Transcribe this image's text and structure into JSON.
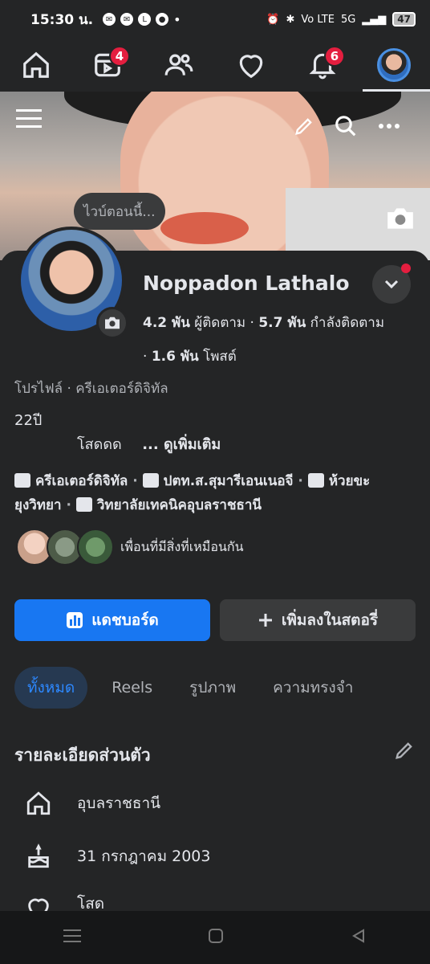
{
  "status_bar": {
    "time": "15:30 น.",
    "network": "5G",
    "volte": "Vo LTE",
    "battery": "47"
  },
  "top_nav": {
    "reels_badge": "4",
    "notifications_badge": "6"
  },
  "cover": {
    "bubble_text": "ไวบ์ตอนนี้..."
  },
  "profile": {
    "name": "Noppadon Lathalo",
    "followers_count": "4.2 พัน",
    "followers_label": "ผู้ติดตาม",
    "following_count": "5.7 พัน",
    "following_label": "กำลังติดตาม",
    "posts_count": "1.6 พัน",
    "posts_label": "โพสต์",
    "category": "โปรไฟล์ · ครีเอเตอร์ดิจิทัล",
    "age": "22ปี",
    "bio": "โสดดด",
    "see_more": "... ดูเพิ่มเติม",
    "details_line1_a": "ครีเอเตอร์ดิจิทัล",
    "details_line1_b": "ปตท.ส.สุมารีเอนเนอจี",
    "details_line1_c": "ห้วยขะ",
    "details_line2_a": "ยุงวิทยา",
    "details_line2_b": "วิทยาลัยเทคนิคอุบลราชธานี",
    "mutual_text": "เพื่อนที่มีสิ่งที่เหมือนกัน"
  },
  "actions": {
    "dashboard_label": "แดชบอร์ด",
    "add_story_label": "เพิ่มลงในสตอรี่"
  },
  "tabs": [
    "ทั้งหมด",
    "Reels",
    "รูปภาพ",
    "ความทรงจำ"
  ],
  "details": {
    "title": "รายละเอียดส่วนตัว",
    "hometown": "อุบลราชธานี",
    "birthday": "31 กรกฎาคม  2003",
    "relationship": "โสด"
  },
  "colors": {
    "background": "#242526",
    "primary": "#1877f2",
    "badge": "#e41e3f"
  }
}
